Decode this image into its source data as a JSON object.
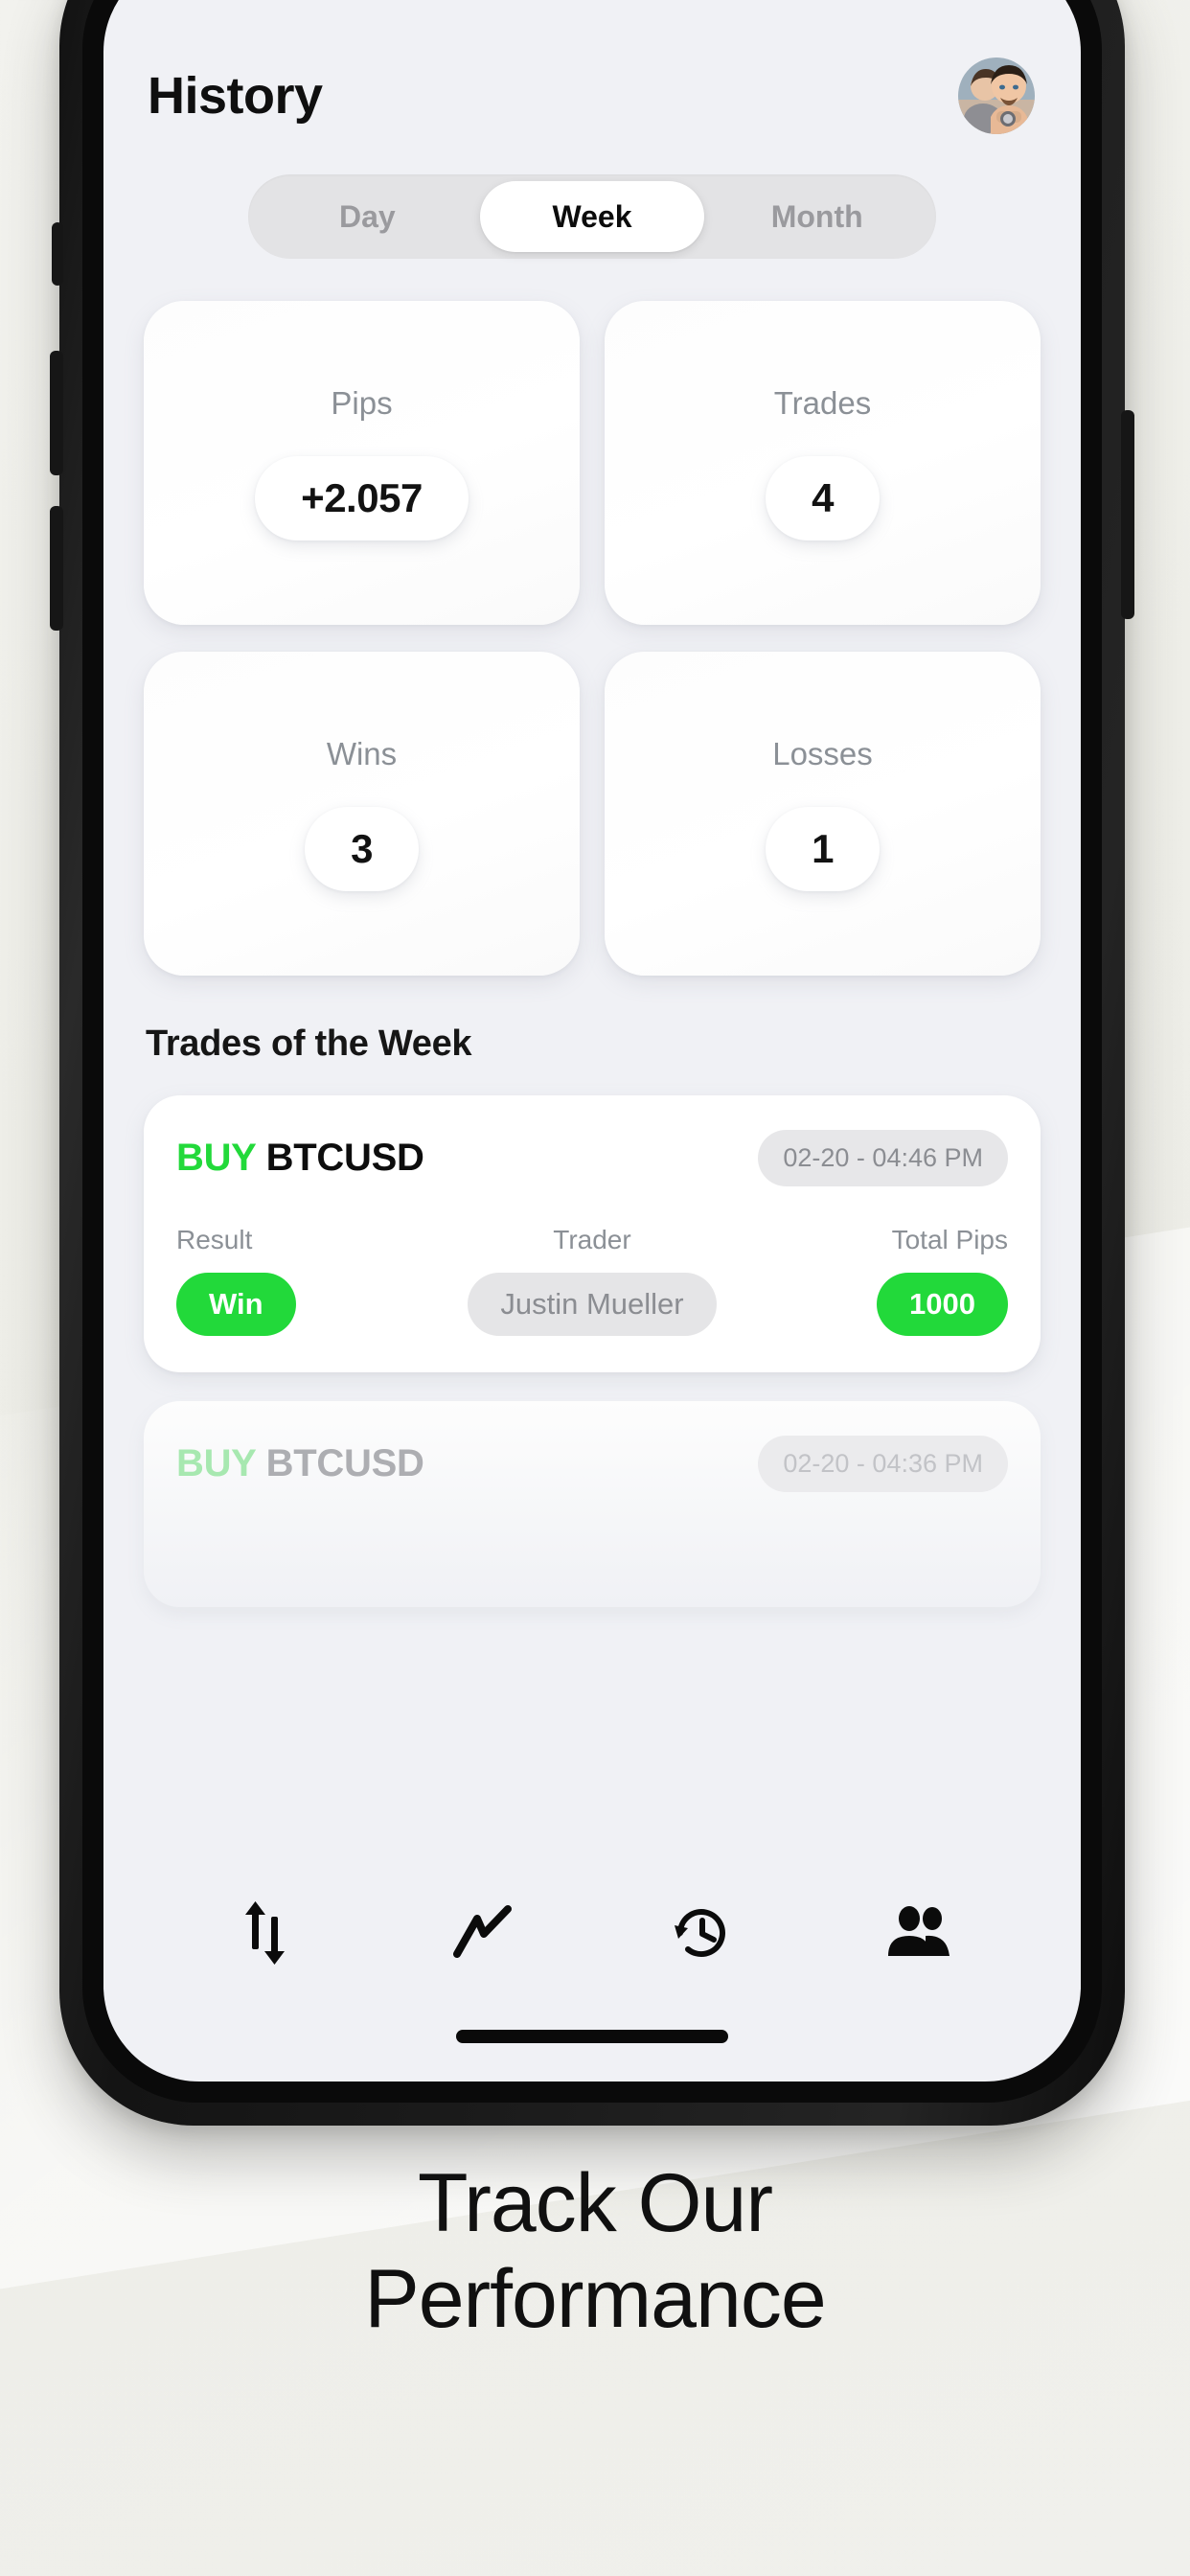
{
  "app": {
    "header": {
      "title": "History",
      "avatar_icon": "user-avatar-photo"
    },
    "period_tabs": [
      {
        "label": "Day",
        "active": false
      },
      {
        "label": "Week",
        "active": true
      },
      {
        "label": "Month",
        "active": false
      }
    ],
    "stats": [
      {
        "label": "Pips",
        "value": "+2.057"
      },
      {
        "label": "Trades",
        "value": "4"
      },
      {
        "label": "Wins",
        "value": "3"
      },
      {
        "label": "Losses",
        "value": "1"
      }
    ],
    "section": {
      "title": "Trades of the Week"
    },
    "trades": [
      {
        "side": "BUY",
        "symbol": "BTCUSD",
        "datetime": "02-20 - 04:46 PM",
        "columns": [
          {
            "label": "Result",
            "value": "Win"
          },
          {
            "label": "Trader",
            "value": "Justin Mueller"
          },
          {
            "label": "Total Pips",
            "value": "1000"
          }
        ]
      },
      {
        "side": "BUY",
        "symbol": "BTCUSD",
        "datetime": "02-20 - 04:36 PM"
      }
    ],
    "tabbar": [
      {
        "icon": "transfer-arrows-icon"
      },
      {
        "icon": "line-chart-icon"
      },
      {
        "icon": "history-clock-icon"
      },
      {
        "icon": "people-group-icon"
      }
    ]
  },
  "caption": {
    "line1": "Track Our",
    "line2": "Performance"
  },
  "colors": {
    "accent_green": "#22d93a",
    "screen_bg": "#f0f1f5",
    "page_bg": "#eeeee8",
    "muted_text": "#8b9096",
    "pill_grey": "#e5e5e7"
  }
}
